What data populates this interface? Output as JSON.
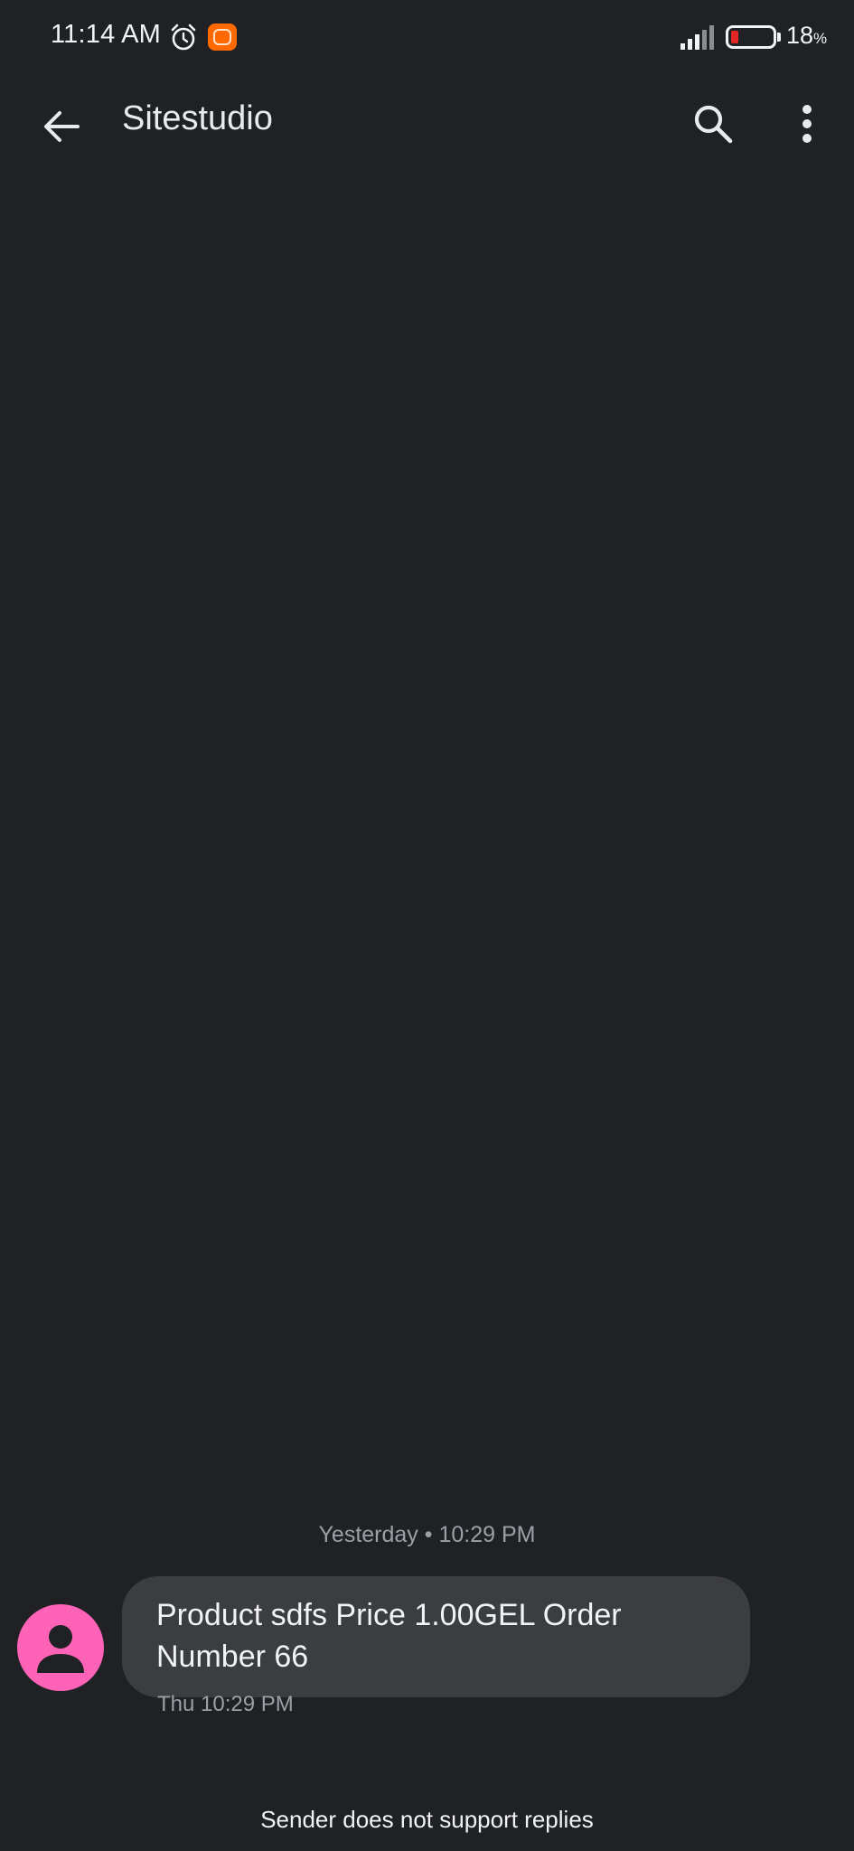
{
  "status_bar": {
    "time": "11:14 AM",
    "battery_level": "18",
    "battery_unit": "%",
    "battery_fraction": 0.18,
    "icons": [
      "alarm-icon",
      "mi-app-icon",
      "signal-icon",
      "battery-icon"
    ],
    "battery_alert_color": "#e32626"
  },
  "header": {
    "title": "Sitestudio",
    "icons": [
      "back-arrow-icon",
      "search-icon",
      "more-vert-icon"
    ]
  },
  "conversation": {
    "date_divider": "Yesterday • 10:29 PM",
    "messages": [
      {
        "text": "Product sdfs Price 1.00GEL Order Number 66",
        "time": "Thu 10:29 PM",
        "avatar_icon": "person-icon",
        "avatar_color": "#ff63b8"
      }
    ]
  },
  "footer": {
    "notice": "Sender does not support replies"
  },
  "colors": {
    "background": "#202125",
    "bubble": "#3c3d41",
    "secondary_text": "#9aa0a6",
    "mi_brand": "#ff6900"
  }
}
